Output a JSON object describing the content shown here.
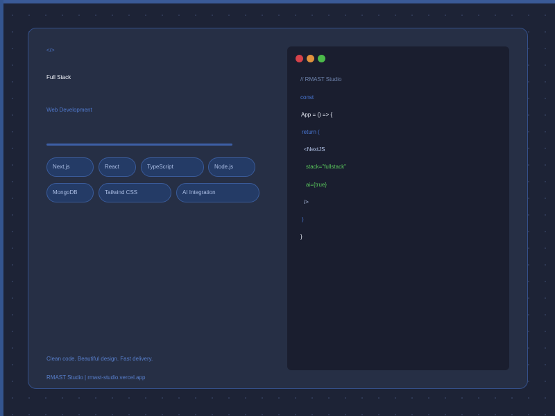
{
  "hero": {
    "code_glyph": "</>",
    "title": "Full Stack",
    "subtitle": "Web Development",
    "chips": [
      "Next.js",
      "React",
      "TypeScript",
      "Node.js",
      "MongoDB",
      "Tailwind CSS",
      "AI Integration"
    ],
    "tagline": "Clean code. Beautiful design. Fast delivery.",
    "credit": "RMAST Studio | rmast-studio.vercel.app"
  },
  "code": {
    "lines": [
      "// RMAST Studio",
      "const",
      "App = () => {",
      "return (",
      "<NextJS",
      "stack=\"fullstack\"",
      "ai={true}",
      "/>",
      ")",
      "}"
    ]
  },
  "colors": {
    "background": "#1d2336",
    "card": "#262f45",
    "accent": "#4a79d8",
    "code_panel": "#1a1e2f",
    "window_red": "#d6424a",
    "window_orange": "#e0923d",
    "window_green": "#4cbb4a"
  }
}
